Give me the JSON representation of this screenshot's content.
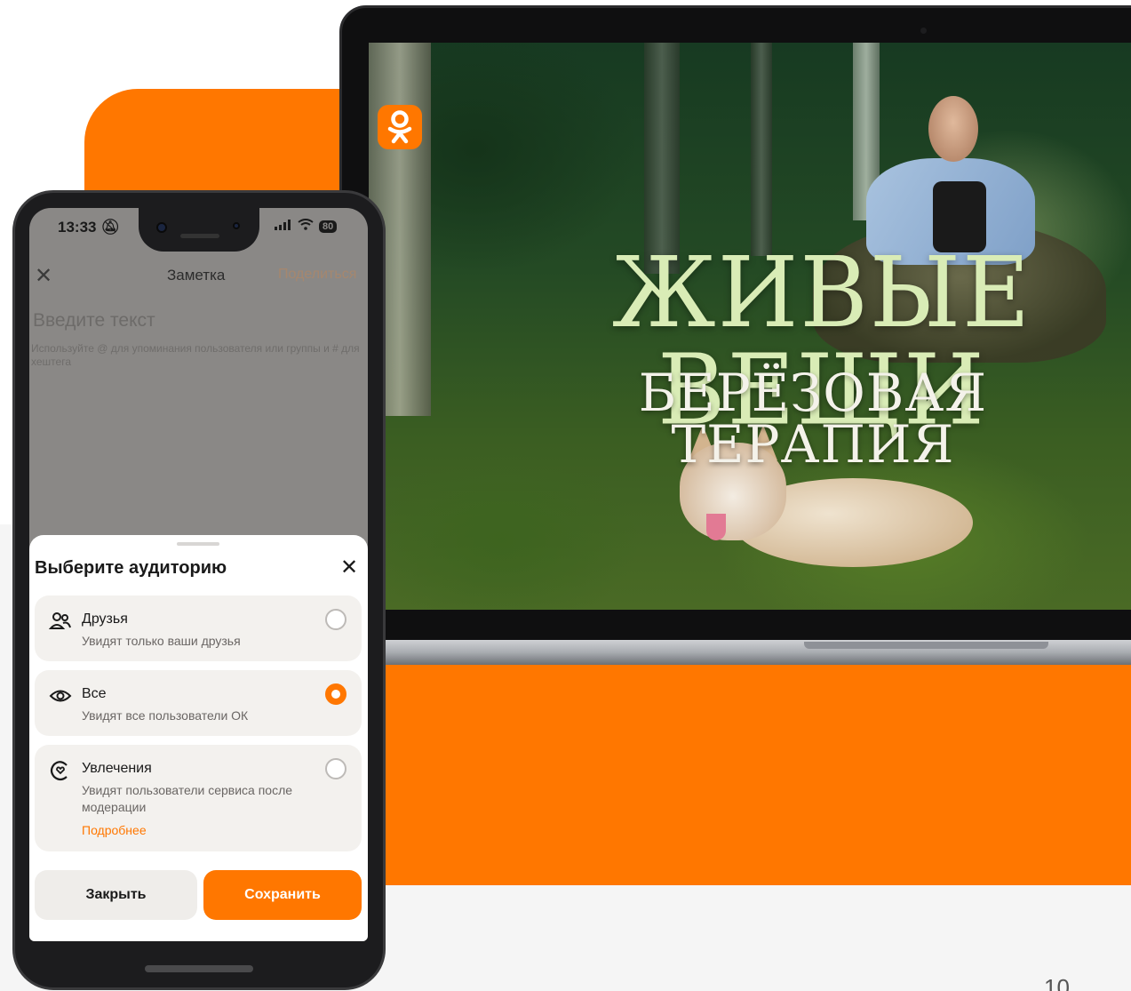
{
  "page": {
    "number": "10"
  },
  "laptop": {
    "logo": "ok-logo-icon",
    "title_main": "ЖИВЫЕ ВЕЩИ",
    "title_sub": "БЕРЁЗОВАЯ ТЕРАПИЯ"
  },
  "phone": {
    "status": {
      "time": "13:33",
      "mute_icon": "bell-off-icon",
      "battery": "80"
    },
    "note": {
      "close_icon": "close-icon",
      "title": "Заметка",
      "share": "Поделиться",
      "placeholder": "Введите текст",
      "hint": "Используйте @ для упоминания пользователя или группы и # для хештега"
    },
    "sheet": {
      "title": "Выберите аудиторию",
      "options": [
        {
          "icon": "friends-icon",
          "label": "Друзья",
          "description": "Увидят только ваши друзья",
          "selected": false
        },
        {
          "icon": "eye-icon",
          "label": "Все",
          "description": "Увидят все пользователи ОК",
          "selected": true
        },
        {
          "icon": "hobby-icon",
          "label": "Увлечения",
          "description": "Увидят пользователи сервиса после модерации",
          "link": "Подробнее",
          "selected": false
        }
      ],
      "close_button": "Закрыть",
      "save_button": "Сохранить"
    }
  },
  "colors": {
    "accent": "#ff7700",
    "sheet_bg": "#ffffff",
    "option_bg": "#f3f1ee"
  }
}
